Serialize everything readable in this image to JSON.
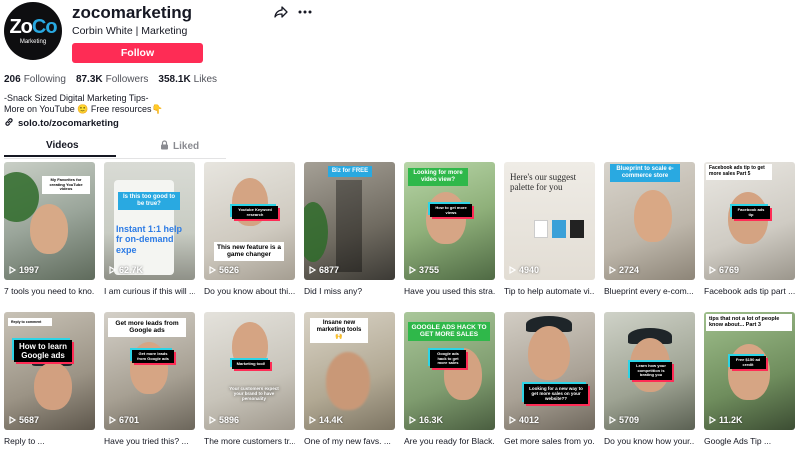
{
  "profile": {
    "username": "zocomarketing",
    "display_name": "Corbin White | Marketing",
    "follow_label": "Follow",
    "avatar": {
      "main": "ZoCo",
      "sub": "Marketing",
      "accent": "#29a9e1"
    },
    "stats": {
      "following": {
        "value": "206",
        "label": "Following"
      },
      "followers": {
        "value": "87.3K",
        "label": "Followers"
      },
      "likes": {
        "value": "358.1K",
        "label": "Likes"
      }
    },
    "bio": [
      "-Snack Sized Digital Marketing Tips-",
      "More on YouTube 🙂 Free resources👇"
    ],
    "link": "solo.to/zocomarketing"
  },
  "tabs": {
    "videos": "Videos",
    "liked": "Liked"
  },
  "colors": {
    "follow": "#fe2c55",
    "overlay_blue": "#29a9e1",
    "overlay_green": "#2fb84a"
  },
  "videos": [
    {
      "views": "1997",
      "caption": "7 tools you need to kno...",
      "overlay": "My Favorites for creating YouTube videos"
    },
    {
      "views": "62.7K",
      "caption": "I am curious if this will ...",
      "overlay": "Is this too good to be true?"
    },
    {
      "views": "5626",
      "caption": "Do you know about thi...",
      "overlay": "Youtube Keyword research",
      "overlay2": "This new feature is a game changer"
    },
    {
      "views": "6877",
      "caption": "Did I miss any?",
      "overlay": "Biz for FREE"
    },
    {
      "views": "3755",
      "caption": "Have you used this stra...",
      "overlay": "Looking for more video view?",
      "overlay2": "How to get more views"
    },
    {
      "views": "4940",
      "caption": "Tip to help automate vi...",
      "overlay": "Here's our suggest palette for you"
    },
    {
      "views": "2724",
      "caption": "Blueprint every e-com...",
      "overlay": "Blueprint to scale e-commerce store"
    },
    {
      "views": "6769",
      "caption": "Facebook ads tip part ...",
      "overlay": "Facebook ads tip to get more sales Part 5",
      "overlay2": "Facebook ads tip"
    },
    {
      "views": "5687",
      "caption": "Reply to ...",
      "overlay": "How to learn Google ads"
    },
    {
      "views": "6701",
      "caption": "Have you tried this? ...",
      "overlay": "Get more leads from Google ads",
      "overlay2": "Get more leads from Google ads"
    },
    {
      "views": "5896",
      "caption": "The more customers tr...",
      "overlay": "Marketing tool!"
    },
    {
      "views": "14.4K",
      "caption": "One of my new favs. ...",
      "overlay": "Insane new marketing tools 🙌"
    },
    {
      "views": "16.3K",
      "caption": "Are you ready for Black...",
      "overlay": "GOOGLE ADS HACK TO GET MORE SALES",
      "overlay2": "Google ads hack to get more sales"
    },
    {
      "views": "4012",
      "caption": "Get more sales from yo...",
      "overlay": "Looking for a new way to get more sales on your website??"
    },
    {
      "views": "5709",
      "caption": "Do you know how your...",
      "overlay": "Learn how your competition is beating you"
    },
    {
      "views": "11.2K",
      "caption": "Google Ads Tip ...",
      "overlay": "tips that not a lot of people know about... Part 3",
      "overlay2": "Free $150 ad credit"
    }
  ]
}
